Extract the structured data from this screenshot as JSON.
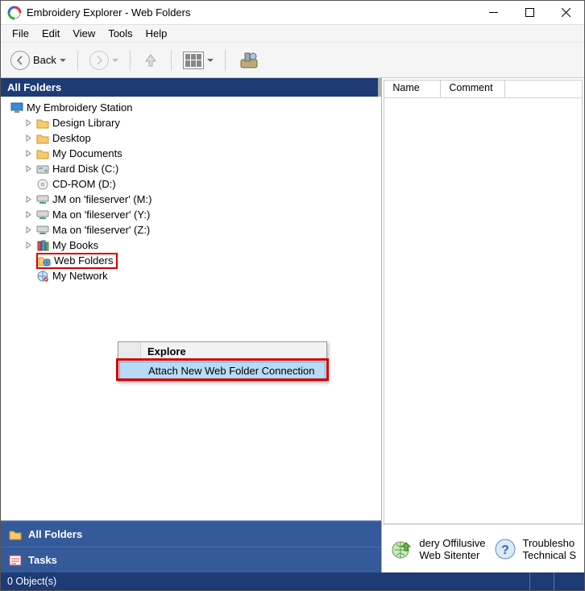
{
  "window": {
    "title": "Embroidery Explorer - Web Folders"
  },
  "menubar": [
    "File",
    "Edit",
    "View",
    "Tools",
    "Help"
  ],
  "toolbar": {
    "back_label": "Back"
  },
  "left": {
    "header": "All Folders",
    "root": "My Embroidery Station",
    "items": [
      {
        "label": "Design Library",
        "icon": "folder",
        "expandable": true
      },
      {
        "label": "Desktop",
        "icon": "folder",
        "expandable": true
      },
      {
        "label": "My Documents",
        "icon": "folder",
        "expandable": true
      },
      {
        "label": "Hard Disk (C:)",
        "icon": "disk",
        "expandable": true
      },
      {
        "label": "CD-ROM (D:)",
        "icon": "cd",
        "expandable": false
      },
      {
        "label": "JM on 'fileserver' (M:)",
        "icon": "netdrive",
        "expandable": true
      },
      {
        "label": "Ma on 'fileserver' (Y:)",
        "icon": "netdrive",
        "expandable": true
      },
      {
        "label": "Ma on 'fileserver' (Z:)",
        "icon": "netdrive",
        "expandable": true
      },
      {
        "label": "My Books",
        "icon": "books",
        "expandable": true
      },
      {
        "label": "Web Folders",
        "icon": "webfolder",
        "expandable": false,
        "selected": true
      },
      {
        "label": "My Network",
        "icon": "network",
        "expandable": false
      }
    ],
    "footer_allfolders": "All Folders",
    "footer_tasks": "Tasks"
  },
  "context_menu": {
    "explore": "Explore",
    "attach": "Attach New Web Folder Connection"
  },
  "right": {
    "columns": [
      "Name",
      "Comment"
    ],
    "links": {
      "a_line1": "dery Offilusive",
      "a_line2": "Web Sitenter",
      "b_line1": "Troublesho",
      "b_line2": "Technical S"
    }
  },
  "statusbar": {
    "objects": "0 Object(s)"
  }
}
